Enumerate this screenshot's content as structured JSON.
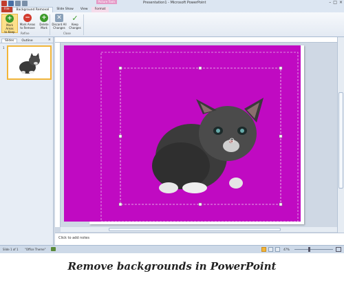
{
  "window": {
    "title": "Presentation1 - Microsoft PowerPoint",
    "context_tab": "Picture Tools",
    "min_btn": "–",
    "max_btn": "□",
    "close_btn": "×"
  },
  "tabs": [
    {
      "label": "File"
    },
    {
      "label": "Background Removal"
    },
    {
      "label": "Slide Show"
    },
    {
      "label": "View"
    },
    {
      "label": "Format"
    }
  ],
  "ribbon": {
    "buttons": [
      {
        "line1": "Mark Areas",
        "line2": "to Keep",
        "glyph": "+",
        "color": "#3c9a2a"
      },
      {
        "line1": "Mark Areas",
        "line2": "to Remove",
        "glyph": "−",
        "color": "#d23b2e"
      },
      {
        "line1": "Delete",
        "line2": "Mark",
        "glyph": "+",
        "color": "#3c9a2a"
      },
      {
        "line1": "Discard All",
        "line2": "Changes",
        "glyph": "✕",
        "color": "#8aa0b8"
      },
      {
        "line1": "Keep",
        "line2": "Changes",
        "glyph": "✓",
        "color": "#3c9a2a"
      }
    ],
    "groups": {
      "refine": "Refine",
      "close": "Close"
    }
  },
  "sidebar": {
    "tabs": [
      "Slides",
      "Outline"
    ],
    "close": "×",
    "slide_number": "1"
  },
  "notes": {
    "placeholder": "Click to add notes"
  },
  "status": {
    "slide": "Slide 1 of 1",
    "theme": "\"Office Theme\"",
    "zoom": "47%"
  },
  "caption": "Remove backgrounds in PowerPoint",
  "colors": {
    "background_marked": "#c00ac2",
    "accent_file": "#c23d2d"
  }
}
